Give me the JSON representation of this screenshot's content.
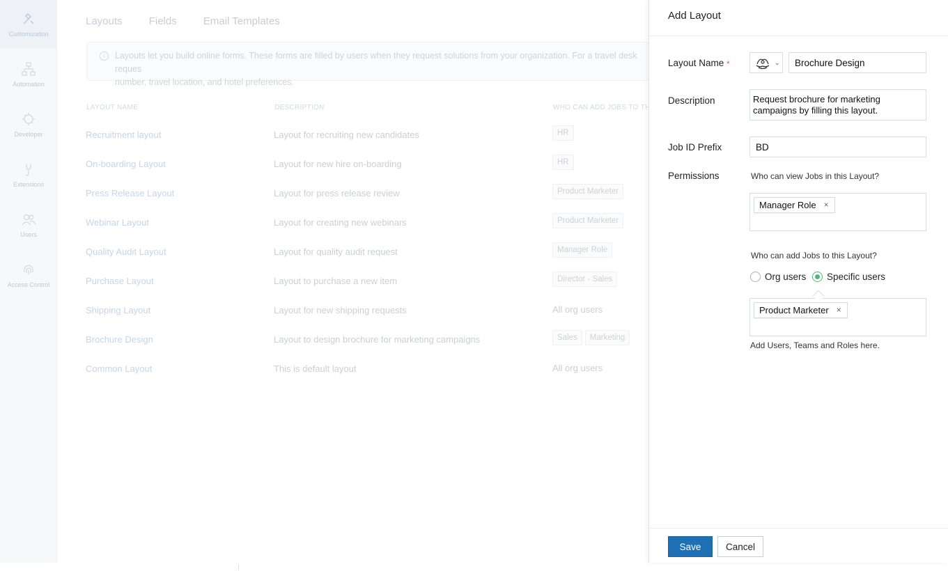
{
  "sidebar": {
    "items": [
      {
        "label": "Customization",
        "icon": "customization-icon",
        "active": true
      },
      {
        "label": "Automation",
        "icon": "automation-icon"
      },
      {
        "label": "Developer",
        "icon": "developer-icon"
      },
      {
        "label": "Extensions",
        "icon": "extensions-icon"
      },
      {
        "label": "Users",
        "icon": "users-icon"
      },
      {
        "label": "Access Control",
        "icon": "fingerprint-icon"
      }
    ]
  },
  "tabs": [
    "Layouts",
    "Fields",
    "Email Templates"
  ],
  "info_text": "Layouts let you build online forms. These forms are filled by users when they request solutions from your organization. For a travel desk reques",
  "info_text_2": "number, travel location, and hotel preferences.",
  "table": {
    "headers": [
      "LAYOUT NAME",
      "DESCRIPTION",
      "WHO CAN ADD JOBS TO TH"
    ],
    "rows": [
      {
        "name": "Recruitment layout",
        "description": "Layout for recruiting new candidates",
        "who": [
          "HR"
        ]
      },
      {
        "name": "On-boarding Layout",
        "description": "Layout for new hire on-boarding",
        "who": [
          "HR"
        ]
      },
      {
        "name": "Press Release Layout",
        "description": "Layout for press release review",
        "who": [
          "Product Marketer"
        ]
      },
      {
        "name": "Webinar Layout",
        "description": "Layout for creating new webinars",
        "who": [
          "Product Marketer"
        ]
      },
      {
        "name": "Quality Audit Layout",
        "description": "Layout for quality audit request",
        "who": [
          "Manager Role"
        ]
      },
      {
        "name": "Purchase Layout",
        "description": "Layout to purchase a new item",
        "who": [
          "Director - Sales"
        ]
      },
      {
        "name": "Shipping Layout",
        "description": "Layout for new shipping requests",
        "who_text": "All org users"
      },
      {
        "name": "Brochure Design",
        "description": "Layout to design brochure for marketing campaigns",
        "who": [
          "Sales",
          "Marketing"
        ]
      },
      {
        "name": "Common Layout",
        "description": "This is default layout",
        "who_text": "All org users"
      }
    ]
  },
  "panel": {
    "title": "Add Layout",
    "layout_name_label": "Layout Name",
    "required_mark": "*",
    "layout_name_value": "Brochure Design",
    "description_label": "Description",
    "description_value": "Request brochure for marketing campaigns by filling this layout.",
    "prefix_label": "Job ID Prefix",
    "prefix_value": "BD",
    "permissions_label": "Permissions",
    "view_question": "Who can view Jobs in this Layout?",
    "view_tag": "Manager Role",
    "add_question": "Who can add Jobs to this Layout?",
    "radio_org": "Org users",
    "radio_specific": "Specific users",
    "add_tag": "Product Marketer",
    "tag_remove": "×",
    "hint": "Add Users, Teams and Roles here.",
    "save_label": "Save",
    "cancel_label": "Cancel",
    "accent_color": "#1f6fb5",
    "radio_color": "#58b37a"
  }
}
